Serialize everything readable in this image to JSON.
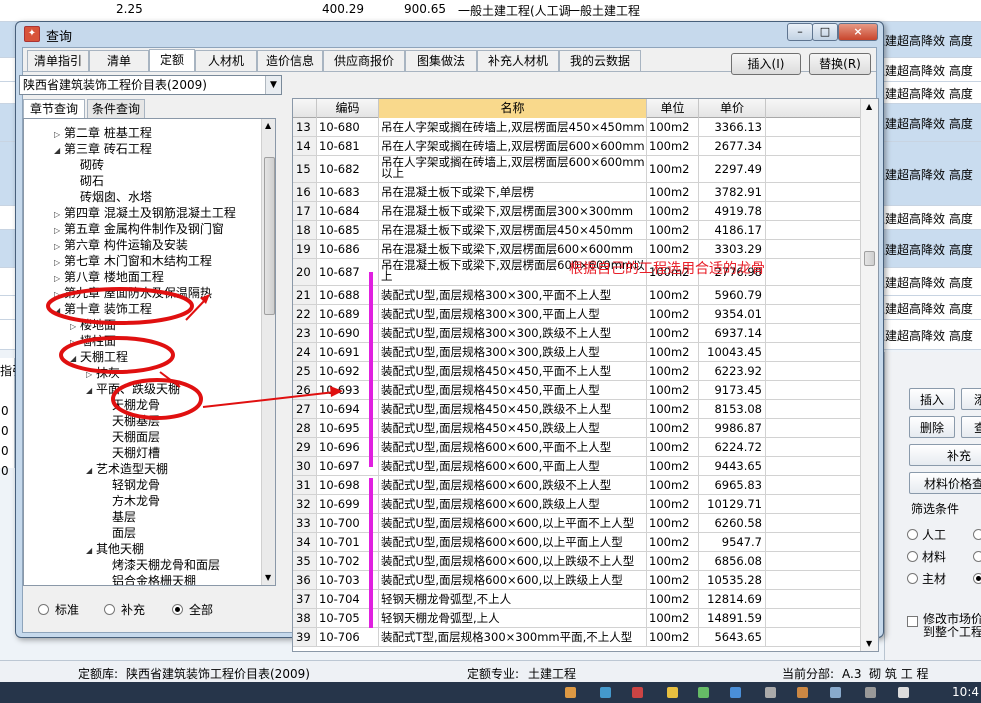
{
  "background_app": {
    "rows": [
      {
        "value_a": "2.25",
        "value_b": "400.29",
        "value_c": "900.65",
        "desc_a": "一般土建工程(人工调",
        "desc_b": "一般土建工程"
      },
      {
        "right_text": "土建超高降效 高度"
      },
      {
        "right_text": "土建超高降效 高度"
      },
      {
        "right_text": "土建超高降效 高度"
      },
      {
        "right_text": "土建超高降效 高度"
      },
      {
        "right_text": "土建超高降效 高度"
      },
      {
        "right_text": "土建超高降效 高度"
      },
      {
        "right_text": "土建超高降效 高度"
      },
      {
        "right_text": "土建超高降效 高度"
      },
      {
        "right_text": "土建超高降效 高度"
      },
      {
        "right_text": "土建超高降效 高度"
      }
    ],
    "left_partial": {
      "label": "指引",
      "cells": [
        "0",
        "0",
        "0",
        "0"
      ]
    },
    "right_panel": {
      "insert_button": "插入",
      "add_button_partial": "添",
      "delete_button": "删除",
      "query_button_partial": "查",
      "supplement_button": "补充",
      "material_price_button": "材料价格查",
      "filter_title": "筛选条件",
      "filter_options": [
        "人工",
        "材料",
        "主材"
      ],
      "modify_market_text": "修改市场价",
      "modify_market_text2": "到整个工程"
    },
    "status_bar": {
      "quota_library_label": "定额库:",
      "quota_library_value": "陕西省建筑装饰工程价目表(2009)",
      "specialty_label": "定额专业:",
      "specialty_value": "土建工程",
      "current_section_label": "当前分部:",
      "current_section_value": "A.3  砌 筑 工 程"
    },
    "taskbar": {
      "clock": "10:4"
    }
  },
  "dialog": {
    "title": "查询",
    "window_buttons": {
      "minimize": "–",
      "maximize": "□",
      "close": "×"
    },
    "tabs": [
      "清单指引",
      "清单",
      "定额",
      "人材机",
      "造价信息",
      "供应商报价",
      "图集做法",
      "补充人材机",
      "我的云数据"
    ],
    "active_tab": "定额",
    "insert_button": "插入(I)",
    "replace_button": "替换(R)",
    "library_select": "陕西省建筑装饰工程价目表(2009)",
    "subtabs": [
      "章节查询",
      "条件查询"
    ],
    "tree": [
      {
        "label": "第二章 桩基工程",
        "level": 0,
        "expander": "closed"
      },
      {
        "label": "第三章 砖石工程",
        "level": 0,
        "expander": "open"
      },
      {
        "label": "砌砖",
        "level": 1,
        "expander": "none"
      },
      {
        "label": "砌石",
        "level": 1,
        "expander": "none"
      },
      {
        "label": "砖烟囱、水塔",
        "level": 1,
        "expander": "none"
      },
      {
        "label": "第四章 混凝土及钢筋混凝土工程",
        "level": 0,
        "expander": "closed"
      },
      {
        "label": "第五章 金属构件制作及钢门窗",
        "level": 0,
        "expander": "closed"
      },
      {
        "label": "第六章 构件运输及安装",
        "level": 0,
        "expander": "closed"
      },
      {
        "label": "第七章 木门窗和木结构工程",
        "level": 0,
        "expander": "closed"
      },
      {
        "label": "第八章 楼地面工程",
        "level": 0,
        "expander": "closed"
      },
      {
        "label": "第九章 屋面防水及保温隔热",
        "level": 0,
        "expander": "closed"
      },
      {
        "label": "第十章 装饰工程",
        "level": 0,
        "expander": "open"
      },
      {
        "label": "楼地面",
        "level": 1,
        "expander": "closed"
      },
      {
        "label": "墙柱面",
        "level": 1,
        "expander": "closed"
      },
      {
        "label": "天棚工程",
        "level": 1,
        "expander": "open"
      },
      {
        "label": "抹灰",
        "level": 2,
        "expander": "closed"
      },
      {
        "label": "平面、跌级天棚",
        "level": 2,
        "expander": "open"
      },
      {
        "label": "天棚龙骨",
        "level": 3,
        "expander": "none"
      },
      {
        "label": "天棚基层",
        "level": 3,
        "expander": "none"
      },
      {
        "label": "天棚面层",
        "level": 3,
        "expander": "none"
      },
      {
        "label": "天棚灯槽",
        "level": 3,
        "expander": "none"
      },
      {
        "label": "艺术造型天棚",
        "level": 2,
        "expander": "open"
      },
      {
        "label": "轻钢龙骨",
        "level": 3,
        "expander": "none"
      },
      {
        "label": "方木龙骨",
        "level": 3,
        "expander": "none"
      },
      {
        "label": "基层",
        "level": 3,
        "expander": "none"
      },
      {
        "label": "面层",
        "level": 3,
        "expander": "none"
      },
      {
        "label": "其他天棚",
        "level": 2,
        "expander": "open"
      },
      {
        "label": "烤漆天棚龙骨和面层",
        "level": 3,
        "expander": "none"
      },
      {
        "label": "铝合金格栅天棚",
        "level": 3,
        "expander": "none"
      }
    ],
    "bottom_radios": [
      {
        "label": "标准",
        "checked": false
      },
      {
        "label": "补充",
        "checked": false
      },
      {
        "label": "全部",
        "checked": true
      }
    ],
    "grid": {
      "columns": [
        "编码",
        "名称",
        "单位",
        "单价"
      ],
      "rows": [
        {
          "n": "13",
          "code": "10-680",
          "name": "吊在人字架或搁在砖墙上,双层楞面层450×450mm",
          "unit": "100m2",
          "price": "3366.13"
        },
        {
          "n": "14",
          "code": "10-681",
          "name": "吊在人字架或搁在砖墙上,双层楞面层600×600mm",
          "unit": "100m2",
          "price": "2677.34"
        },
        {
          "n": "15",
          "code": "10-682",
          "name": "吊在人字架或搁在砖墙上,双层楞面层600×600mm以上",
          "unit": "100m2",
          "price": "2297.49"
        },
        {
          "n": "16",
          "code": "10-683",
          "name": "吊在混凝土板下或梁下,单层楞",
          "unit": "100m2",
          "price": "3782.91"
        },
        {
          "n": "17",
          "code": "10-684",
          "name": "吊在混凝土板下或梁下,双层楞面层300×300mm",
          "unit": "100m2",
          "price": "4919.78"
        },
        {
          "n": "18",
          "code": "10-685",
          "name": "吊在混凝土板下或梁下,双层楞面层450×450mm",
          "unit": "100m2",
          "price": "4186.17"
        },
        {
          "n": "19",
          "code": "10-686",
          "name": "吊在混凝土板下或梁下,双层楞面层600×600mm",
          "unit": "100m2",
          "price": "3303.29"
        },
        {
          "n": "20",
          "code": "10-687",
          "name": "吊在混凝土板下或梁下,双层楞面层600×600mm以上",
          "unit": "100m2",
          "price": "2776.98"
        },
        {
          "n": "21",
          "code": "10-688",
          "name": "装配式U型,面层规格300×300,平面不上人型",
          "unit": "100m2",
          "price": "5960.79"
        },
        {
          "n": "22",
          "code": "10-689",
          "name": "装配式U型,面层规格300×300,平面上人型",
          "unit": "100m2",
          "price": "9354.01"
        },
        {
          "n": "23",
          "code": "10-690",
          "name": "装配式U型,面层规格300×300,跌级不上人型",
          "unit": "100m2",
          "price": "6937.14"
        },
        {
          "n": "24",
          "code": "10-691",
          "name": "装配式U型,面层规格300×300,跌级上人型",
          "unit": "100m2",
          "price": "10043.45"
        },
        {
          "n": "25",
          "code": "10-692",
          "name": "装配式U型,面层规格450×450,平面不上人型",
          "unit": "100m2",
          "price": "6223.92"
        },
        {
          "n": "26",
          "code": "10-693",
          "name": "装配式U型,面层规格450×450,平面上人型",
          "unit": "100m2",
          "price": "9173.45"
        },
        {
          "n": "27",
          "code": "10-694",
          "name": "装配式U型,面层规格450×450,跌级不上人型",
          "unit": "100m2",
          "price": "8153.08"
        },
        {
          "n": "28",
          "code": "10-695",
          "name": "装配式U型,面层规格450×450,跌级上人型",
          "unit": "100m2",
          "price": "9986.87"
        },
        {
          "n": "29",
          "code": "10-696",
          "name": "装配式U型,面层规格600×600,平面不上人型",
          "unit": "100m2",
          "price": "6224.72"
        },
        {
          "n": "30",
          "code": "10-697",
          "name": "装配式U型,面层规格600×600,平面上人型",
          "unit": "100m2",
          "price": "9443.65"
        },
        {
          "n": "31",
          "code": "10-698",
          "name": "装配式U型,面层规格600×600,跌级不上人型",
          "unit": "100m2",
          "price": "6965.83"
        },
        {
          "n": "32",
          "code": "10-699",
          "name": "装配式U型,面层规格600×600,跌级上人型",
          "unit": "100m2",
          "price": "10129.71"
        },
        {
          "n": "33",
          "code": "10-700",
          "name": "装配式U型,面层规格600×600,以上平面不上人型",
          "unit": "100m2",
          "price": "6260.58"
        },
        {
          "n": "34",
          "code": "10-701",
          "name": "装配式U型,面层规格600×600,以上平面上人型",
          "unit": "100m2",
          "price": "9547.7"
        },
        {
          "n": "35",
          "code": "10-702",
          "name": "装配式U型,面层规格600×600,以上跌级不上人型",
          "unit": "100m2",
          "price": "6856.08"
        },
        {
          "n": "36",
          "code": "10-703",
          "name": "装配式U型,面层规格600×600,以上跌级上人型",
          "unit": "100m2",
          "price": "10535.28"
        },
        {
          "n": "37",
          "code": "10-704",
          "name": "轻钢天棚龙骨弧型,不上人",
          "unit": "100m2",
          "price": "12814.69"
        },
        {
          "n": "38",
          "code": "10-705",
          "name": "轻钢天棚龙骨弧型,上人",
          "unit": "100m2",
          "price": "14891.59"
        },
        {
          "n": "39",
          "code": "10-706",
          "name": "装配式T型,面层规格300×300mm平面,不上人型",
          "unit": "100m2",
          "price": "5643.65"
        }
      ]
    },
    "annotation_text": "根据自己的工程选用合适的龙骨",
    "annotation_color": "#e8202a",
    "highlight_color": "#e01010",
    "bracket_color": "#e020e0"
  }
}
